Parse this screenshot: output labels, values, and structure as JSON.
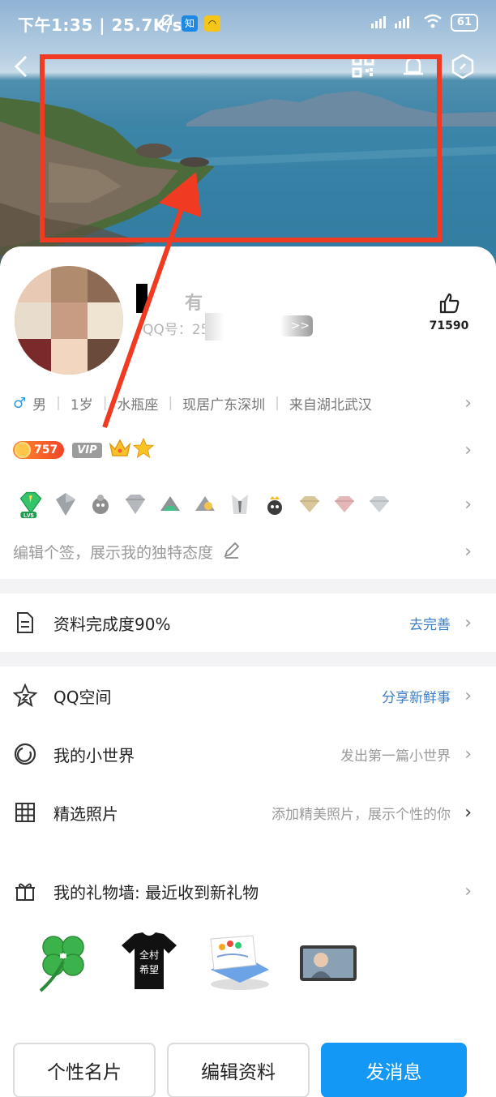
{
  "status_bar": {
    "time": "下午1:35",
    "speed": "25.7K/s",
    "zhi_badge": "知",
    "battery": "61"
  },
  "header": {
    "back_icon": "back-arrow-icon",
    "qr_icon": "qr-code-icon",
    "bell_icon": "bell-icon",
    "settings_icon": "hexagon-settings-icon"
  },
  "profile": {
    "name_suffix": "有",
    "qq_label": "QQ号：250",
    "level_badge": ">>",
    "like_count": "71590"
  },
  "info": {
    "gender": "男",
    "age": "1岁",
    "zodiac": "水瓶座",
    "location": "现居广东深圳",
    "hometown": "来自湖北武汉"
  },
  "vip": {
    "coins": "757",
    "vip_label": "VIP"
  },
  "badges": {
    "level": "LV5"
  },
  "signature": {
    "placeholder": "编辑个签，展示我的独特态度"
  },
  "completion": {
    "label": "资料完成度90%",
    "action": "去完善"
  },
  "menu": [
    {
      "label": "QQ空间",
      "hint": "分享新鲜事"
    },
    {
      "label": "我的小世界",
      "hint": "发出第一篇小世界"
    },
    {
      "label": "精选照片",
      "hint": "添加精美照片，展示个性的你"
    },
    {
      "label": "我的礼物墙: 最近收到新礼物",
      "hint": ""
    }
  ],
  "gifts": {
    "tshirt_text_1": "全村",
    "tshirt_text_2": "希望"
  },
  "buttons": {
    "card": "个性名片",
    "edit": "编辑资料",
    "message": "发消息"
  },
  "colors": {
    "highlight": "#f03a22",
    "primary": "#1398f6",
    "link": "#3c7fc6"
  }
}
